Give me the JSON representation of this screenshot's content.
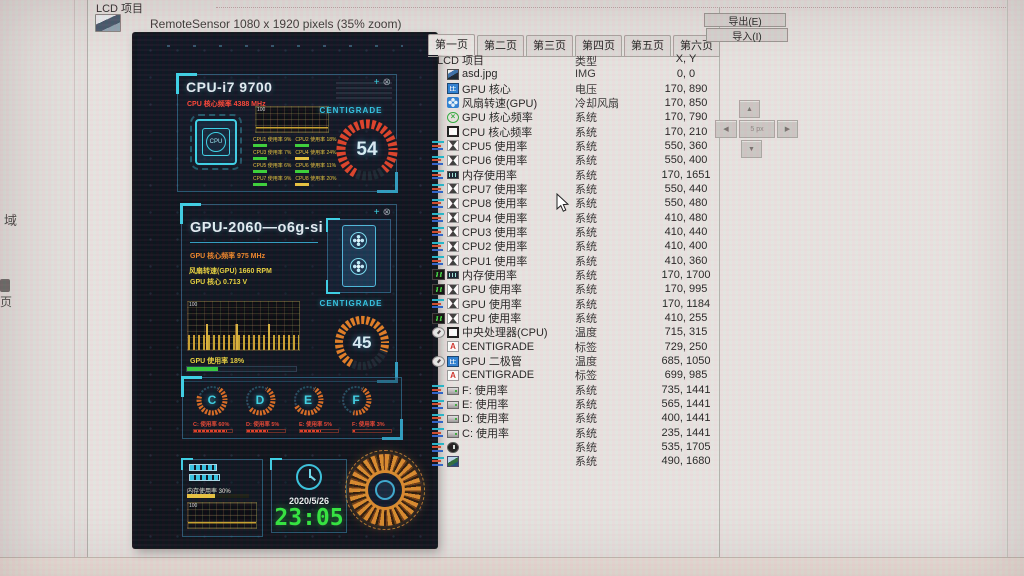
{
  "page": {
    "group_title": "LCD 项目",
    "preview_caption": "RemoteSensor 1080 x 1920 pixels (35% zoom)",
    "sidebar_text_top": "域",
    "sidebar_text_bottom": "页"
  },
  "toolbar": {
    "export_label": "导出(E)",
    "import_label": "导入(I)",
    "nudge": {
      "up": "▲",
      "left": "◀",
      "right": "▶",
      "down": "▼",
      "step": "5 px"
    }
  },
  "tabs": {
    "items": [
      "第一页",
      "第二页",
      "第三页",
      "第四页",
      "第五页",
      "第六页"
    ],
    "active": 0
  },
  "table": {
    "headers": {
      "name": "LCD 项目",
      "type": "类型",
      "xy": "X, Y"
    },
    "rows": [
      {
        "lead": null,
        "icon": "image-icon",
        "name": "asd.jpg",
        "type": "IMG",
        "xy": "0, 0"
      },
      {
        "lead": null,
        "icon": "chip-icon",
        "name": "GPU 核心",
        "type": "电压",
        "xy": "170, 890"
      },
      {
        "lead": null,
        "icon": "fan-icon",
        "name": "风扇转速(GPU)",
        "type": "冷却风扇",
        "xy": "170, 850"
      },
      {
        "lead": null,
        "icon": "frequency-icon",
        "name": "GPU 核心频率",
        "type": "系统",
        "xy": "170, 790"
      },
      {
        "lead": null,
        "icon": "square-icon",
        "name": "CPU 核心频率",
        "type": "系统",
        "xy": "170, 210"
      },
      {
        "lead": "bars-icon",
        "icon": "hourglass-icon",
        "name": "CPU5 使用率",
        "type": "系统",
        "xy": "550, 360"
      },
      {
        "lead": "bars-icon",
        "icon": "hourglass-icon",
        "name": "CPU6 使用率",
        "type": "系统",
        "xy": "550, 400"
      },
      {
        "lead": "bars-icon",
        "icon": "memory-icon",
        "name": "内存使用率",
        "type": "系统",
        "xy": "170, 1651"
      },
      {
        "lead": "bars-icon",
        "icon": "hourglass-icon",
        "name": "CPU7 使用率",
        "type": "系统",
        "xy": "550, 440"
      },
      {
        "lead": "bars-icon",
        "icon": "hourglass-icon",
        "name": "CPU8 使用率",
        "type": "系统",
        "xy": "550, 480"
      },
      {
        "lead": "bars-icon",
        "icon": "hourglass-icon",
        "name": "CPU4 使用率",
        "type": "系统",
        "xy": "410, 480"
      },
      {
        "lead": "bars-icon",
        "icon": "hourglass-icon",
        "name": "CPU3 使用率",
        "type": "系统",
        "xy": "410, 440"
      },
      {
        "lead": "bars-icon",
        "icon": "hourglass-icon",
        "name": "CPU2 使用率",
        "type": "系统",
        "xy": "410, 400"
      },
      {
        "lead": "bars-icon",
        "icon": "hourglass-icon",
        "name": "CPU1 使用率",
        "type": "系统",
        "xy": "410, 360"
      },
      {
        "lead": "graph-icon",
        "icon": "memory-icon",
        "name": "内存使用率",
        "type": "系统",
        "xy": "170, 1700"
      },
      {
        "lead": "graph-icon",
        "icon": "hourglass-icon",
        "name": "GPU 使用率",
        "type": "系统",
        "xy": "170, 995"
      },
      {
        "lead": "bars-icon",
        "icon": "hourglass-icon",
        "name": "GPU 使用率",
        "type": "系统",
        "xy": "170, 1184"
      },
      {
        "lead": "graph-icon",
        "icon": "hourglass-icon",
        "name": "CPU 使用率",
        "type": "系统",
        "xy": "410, 255"
      },
      {
        "lead": "gauge-icon",
        "icon": "square-icon",
        "name": "中央处理器(CPU)",
        "type": "温度",
        "xy": "715, 315"
      },
      {
        "lead": null,
        "icon": "label-icon",
        "name": "CENTIGRADE",
        "type": "标签",
        "xy": "729, 250"
      },
      {
        "lead": "gauge-icon",
        "icon": "chip-icon",
        "name": "GPU 二极管",
        "type": "温度",
        "xy": "685, 1050"
      },
      {
        "lead": null,
        "icon": "label-icon",
        "name": "CENTIGRADE",
        "type": "标签",
        "xy": "699, 985"
      },
      {
        "lead": "bars-icon",
        "icon": "drive-icon",
        "name": "F: 使用率",
        "type": "系统",
        "xy": "735, 1441"
      },
      {
        "lead": "bars-icon",
        "icon": "drive-icon",
        "name": "E: 使用率",
        "type": "系统",
        "xy": "565, 1441"
      },
      {
        "lead": "bars-icon",
        "icon": "drive-icon",
        "name": "D: 使用率",
        "type": "系统",
        "xy": "400, 1441"
      },
      {
        "lead": "bars-icon",
        "icon": "drive-icon",
        "name": "C: 使用率",
        "type": "系统",
        "xy": "235, 1441"
      },
      {
        "lead": "bars-icon",
        "icon": "clock-icon",
        "name": "",
        "type": "系统",
        "xy": "535, 1705"
      },
      {
        "lead": "bars-icon",
        "icon": "photo-icon",
        "name": "",
        "type": "系统",
        "xy": "490, 1680"
      }
    ]
  },
  "preview": {
    "cpu": {
      "title": "CPU-i7 9700",
      "subtitle": "CPU 核心频率 4388 MHz",
      "chip_label": "CPU",
      "chart_max": "100",
      "cores": [
        {
          "label": "CPU1 使用率",
          "value": "9%",
          "bar": "green"
        },
        {
          "label": "CPU2 使用率",
          "value": "18%",
          "bar": "green"
        },
        {
          "label": "CPU3 使用率",
          "value": "7%",
          "bar": "green"
        },
        {
          "label": "CPU4 使用率",
          "value": "24%",
          "bar": "yellow"
        },
        {
          "label": "CPU5 使用率",
          "value": "6%",
          "bar": "green"
        },
        {
          "label": "CPU6 使用率",
          "value": "11%",
          "bar": "green"
        },
        {
          "label": "CPU7 使用率",
          "value": "9%",
          "bar": "green"
        },
        {
          "label": "CPU8 使用率",
          "value": "20%",
          "bar": "yellow"
        }
      ],
      "centigrade": "CENTIGRADE",
      "temp": "54",
      "arc_dash": "82 18",
      "plus": "+",
      "close": "⊗"
    },
    "gpu": {
      "title": "GPU-2060—o6g-si",
      "line1": "GPU 核心频率 975 MHz",
      "line2": "风扇转速(GPU) 1660 RPM",
      "line3": "GPU 核心 0.713 V",
      "chart_max": "100",
      "usage_label": "GPU 使用率 18%",
      "usage_bar_pct": 28,
      "centigrade": "CENTIGRADE",
      "temp": "45",
      "arc_dash": "74 26",
      "plus": "+",
      "close": "⊗"
    },
    "drives": [
      {
        "letter": "C",
        "label": "C: 使用率",
        "value": "60%",
        "arc": "72 28",
        "bar": 88
      },
      {
        "letter": "D",
        "label": "D: 使用率",
        "value": "5%",
        "arc": "55 45",
        "bar": 55
      },
      {
        "letter": "E",
        "label": "E: 使用率",
        "value": "5%",
        "arc": "60 40",
        "bar": 55
      },
      {
        "letter": "F",
        "label": "F: 使用率",
        "value": "3%",
        "arc": "45 55",
        "bar": 6
      }
    ],
    "footer": {
      "mem_label": "内存使用率 30%",
      "chart_max": "100",
      "date": "2020/5/26",
      "time": "23:05"
    }
  }
}
